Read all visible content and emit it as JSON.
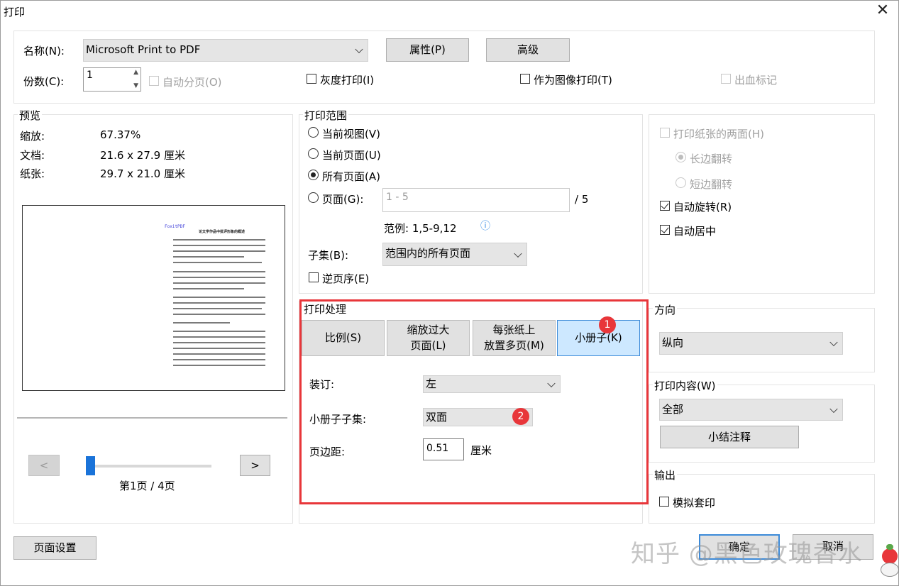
{
  "window": {
    "title": "打印"
  },
  "printer": {
    "name_label": "名称(N):",
    "name_value": "Microsoft Print to PDF",
    "properties_button": "属性(P)",
    "advanced_button": "高级",
    "copies_label": "份数(C):",
    "copies_value": "1",
    "collate_label": "自动分页(O)",
    "grayscale_label": "灰度打印(I)",
    "print_as_image_label": "作为图像打印(T)",
    "bleed_marks_label": "出血标记"
  },
  "preview": {
    "group_label": "预览",
    "zoom_label": "缩放:",
    "zoom_value": "67.37%",
    "document_label": "文档:",
    "document_value": "21.6 x 27.9 厘米",
    "paper_label": "纸张:",
    "paper_value": "29.7 x 21.0 厘米",
    "page_brand": "FoxitPDF",
    "page_heading": "论文学作品中批评形象的概述",
    "prev_button": "<",
    "next_button": ">",
    "slider_position": 0,
    "page_indicator": "第1页 / 4页"
  },
  "range": {
    "group_label": "打印范围",
    "current_view": "当前视图(V)",
    "current_page": "当前页面(U)",
    "all_pages": "所有页面(A)",
    "pages_label": "页面(G):",
    "pages_placeholder": "1 - 5",
    "pages_total": "/ 5",
    "example": "范例:  1,5-9,12",
    "info_icon_glyph": "ⓘ",
    "subset_label": "子集(B):",
    "subset_value": "范围内的所有页面",
    "reverse_label": "逆页序(E)"
  },
  "duplex": {
    "both_sides_label": "打印纸张的两面(H)",
    "long_edge_label": "长边翻转",
    "short_edge_label": "短边翻转",
    "auto_rotate_label": "自动旋转(R)",
    "auto_center_label": "自动居中"
  },
  "handling": {
    "group_label": "打印处理",
    "tab_scale": "比例(S)",
    "tab_shrink_line1": "缩放过大",
    "tab_shrink_line2": "页面(L)",
    "tab_multiple_line1": "每张纸上",
    "tab_multiple_line2": "放置多页(M)",
    "tab_booklet": "小册子(K)",
    "binding_label": "装订:",
    "binding_value": "左",
    "subset_label": "小册子子集:",
    "subset_value": "双面",
    "margin_label": "页边距:",
    "margin_value": "0.51",
    "margin_unit": "厘米",
    "badge_1": "1",
    "badge_2": "2"
  },
  "orientation": {
    "group_label": "方向",
    "value": "纵向"
  },
  "content": {
    "group_label": "打印内容(W)",
    "value": "全部",
    "summarize_button": "小结注释"
  },
  "output": {
    "group_label": "输出",
    "simulate_overprint_label": "模拟套印"
  },
  "footer": {
    "page_setup_button": "页面设置",
    "print_button": "确定",
    "cancel_button": "取消",
    "watermark": "知乎 @黑色玫瑰香水"
  },
  "colors": {
    "accent_red": "#e8363a",
    "selected_tab": "#cde8ff",
    "slider_blue": "#1a73d9"
  }
}
